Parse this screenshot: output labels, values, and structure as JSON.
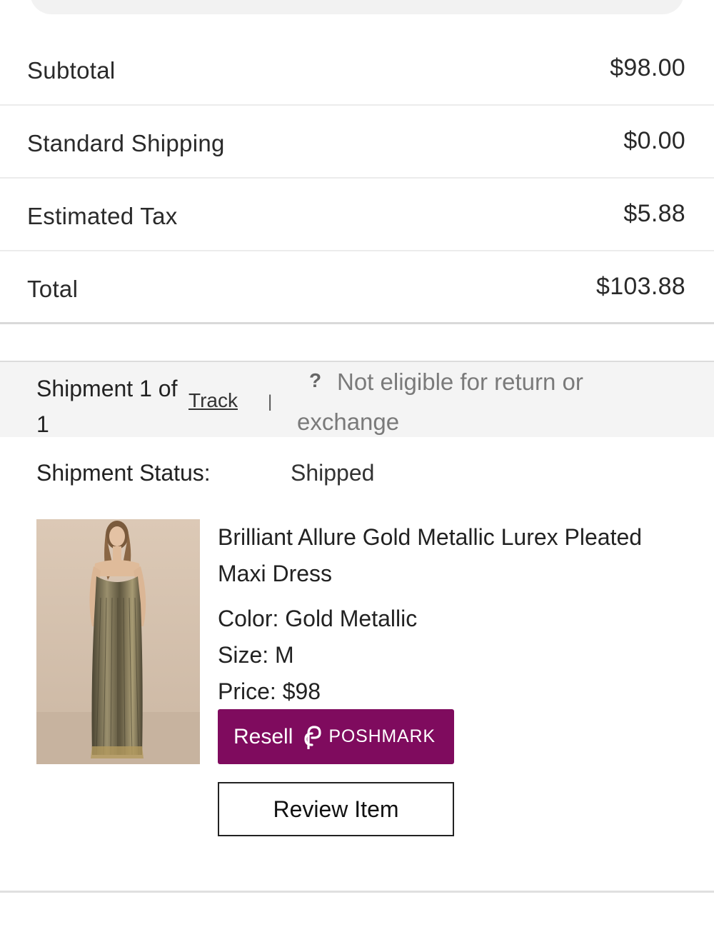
{
  "summary": {
    "subtotal_label": "Subtotal",
    "subtotal_value": "$98.00",
    "shipping_label": "Standard Shipping",
    "shipping_value": "$0.00",
    "tax_label": "Estimated Tax",
    "tax_value": "$5.88",
    "total_label": "Total",
    "total_value": "$103.88"
  },
  "shipment": {
    "title": "Shipment 1 of 1",
    "track_label": "Track",
    "separator": "|",
    "help_icon": "?",
    "eligibility": "Not eligible for return or exchange",
    "status_label": "Shipment Status:",
    "status_value": "Shipped"
  },
  "product": {
    "image_icon": "product-photo",
    "name": "Brilliant Allure Gold Metallic Lurex Pleated Maxi Dress",
    "color": "Color: Gold Metallic",
    "size": "Size: M",
    "price": "Price: $98"
  },
  "actions": {
    "resell_label": "Resell",
    "poshmark_label": "POSHMARK",
    "review_label": "Review Item"
  },
  "colors": {
    "poshmark_brand": "#7f0b5e",
    "header_bg": "#f4f4f4"
  }
}
